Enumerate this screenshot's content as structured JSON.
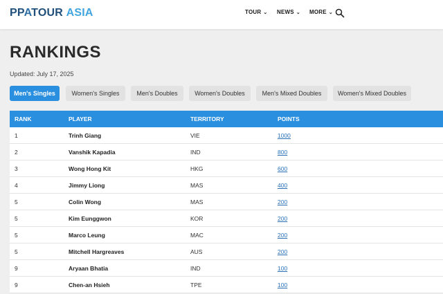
{
  "header": {
    "logo": {
      "part1": "PP",
      "part2": "A",
      "part3": "TOUR",
      "part4": "ASIA"
    },
    "nav": [
      {
        "label": "TOUR"
      },
      {
        "label": "NEWS"
      },
      {
        "label": "MORE"
      }
    ],
    "search_icon": "search-icon"
  },
  "page": {
    "title": "RANKINGS",
    "updated": "Updated: July 17, 2025"
  },
  "tabs": [
    {
      "label": "Men's Singles",
      "active": true
    },
    {
      "label": "Women's Singles",
      "active": false
    },
    {
      "label": "Men's Doubles",
      "active": false
    },
    {
      "label": "Women's Doubles",
      "active": false
    },
    {
      "label": "Men's Mixed Doubles",
      "active": false
    },
    {
      "label": "Women's Mixed Doubles",
      "active": false
    }
  ],
  "table": {
    "headers": {
      "rank": "RANK",
      "player": "PLAYER",
      "territory": "TERRITORY",
      "points": "POINTS"
    },
    "rows": [
      {
        "rank": "1",
        "player": "Trinh Giang",
        "territory": "VIE",
        "points": "1000"
      },
      {
        "rank": "2",
        "player": "Vanshik Kapadia",
        "territory": "IND",
        "points": "800"
      },
      {
        "rank": "3",
        "player": "Wong Hong Kit",
        "territory": "HKG",
        "points": "600"
      },
      {
        "rank": "4",
        "player": "Jimmy Liong",
        "territory": "MAS",
        "points": "400"
      },
      {
        "rank": "5",
        "player": "Colin Wong",
        "territory": "MAS",
        "points": "200"
      },
      {
        "rank": "5",
        "player": "Kim Eunggwon",
        "territory": "KOR",
        "points": "200"
      },
      {
        "rank": "5",
        "player": "Marco Leung",
        "territory": "MAC",
        "points": "200"
      },
      {
        "rank": "5",
        "player": "Mitchell Hargreaves",
        "territory": "AUS",
        "points": "200"
      },
      {
        "rank": "9",
        "player": "Aryaan Bhatia",
        "territory": "IND",
        "points": "100"
      },
      {
        "rank": "9",
        "player": "Chen-an Hsieh",
        "territory": "TPE",
        "points": "100"
      }
    ]
  },
  "colors": {
    "accent": "#2b8fe0",
    "link": "#2a6fb8",
    "logo_dark": "#1f4f7a",
    "logo_light": "#42a5e0"
  }
}
